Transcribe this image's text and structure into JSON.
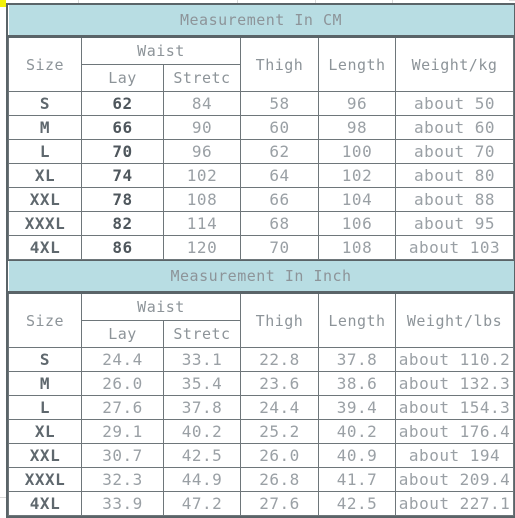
{
  "tables": [
    {
      "title": "Measurement In CM",
      "group_header": "Waist",
      "columns": {
        "size": "Size",
        "lay": "Lay",
        "stretch": "Stretc",
        "thigh": "Thigh",
        "length": "Length",
        "weight": "Weight/kg"
      },
      "rows": [
        {
          "size": "S",
          "lay": "62",
          "stretch": "84",
          "thigh": "58",
          "length": "96",
          "weight": "about 50"
        },
        {
          "size": "M",
          "lay": "66",
          "stretch": "90",
          "thigh": "60",
          "length": "98",
          "weight": "about 60"
        },
        {
          "size": "L",
          "lay": "70",
          "stretch": "96",
          "thigh": "62",
          "length": "100",
          "weight": "about 70"
        },
        {
          "size": "XL",
          "lay": "74",
          "stretch": "102",
          "thigh": "64",
          "length": "102",
          "weight": "about 80"
        },
        {
          "size": "XXL",
          "lay": "78",
          "stretch": "108",
          "thigh": "66",
          "length": "104",
          "weight": "about 88"
        },
        {
          "size": "XXXL",
          "lay": "82",
          "stretch": "114",
          "thigh": "68",
          "length": "106",
          "weight": "about 95"
        },
        {
          "size": "4XL",
          "lay": "86",
          "stretch": "120",
          "thigh": "70",
          "length": "108",
          "weight": "about 103"
        }
      ]
    },
    {
      "title": "Measurement In Inch",
      "group_header": "Waist",
      "columns": {
        "size": "Size",
        "lay": "Lay",
        "stretch": "Stretc",
        "thigh": "Thigh",
        "length": "Length",
        "weight": "Weight/lbs"
      },
      "rows": [
        {
          "size": "S",
          "lay": "24.4",
          "stretch": "33.1",
          "thigh": "22.8",
          "length": "37.8",
          "weight": "about 110.2"
        },
        {
          "size": "M",
          "lay": "26.0",
          "stretch": "35.4",
          "thigh": "23.6",
          "length": "38.6",
          "weight": "about 132.3"
        },
        {
          "size": "L",
          "lay": "27.6",
          "stretch": "37.8",
          "thigh": "24.4",
          "length": "39.4",
          "weight": "about 154.3"
        },
        {
          "size": "XL",
          "lay": "29.1",
          "stretch": "40.2",
          "thigh": "25.2",
          "length": "40.2",
          "weight": "about 176.4"
        },
        {
          "size": "XXL",
          "lay": "30.7",
          "stretch": "42.5",
          "thigh": "26.0",
          "length": "40.9",
          "weight": "about 194"
        },
        {
          "size": "XXXL",
          "lay": "32.3",
          "stretch": "44.9",
          "thigh": "26.8",
          "length": "41.7",
          "weight": "about 209.4"
        },
        {
          "size": "4XL",
          "lay": "33.9",
          "stretch": "47.2",
          "thigh": "27.6",
          "length": "42.5",
          "weight": "about 227.1"
        }
      ]
    }
  ],
  "colors": {
    "title_band": "#b8dde3",
    "border": "#5a6468",
    "inner_border": "#6e767a",
    "title_text": "#7c8488",
    "header_text": "#6f777c",
    "value_text": "#9aa0a5",
    "strong_text": "#4f575d",
    "corner_marker": "#f2f20a"
  }
}
